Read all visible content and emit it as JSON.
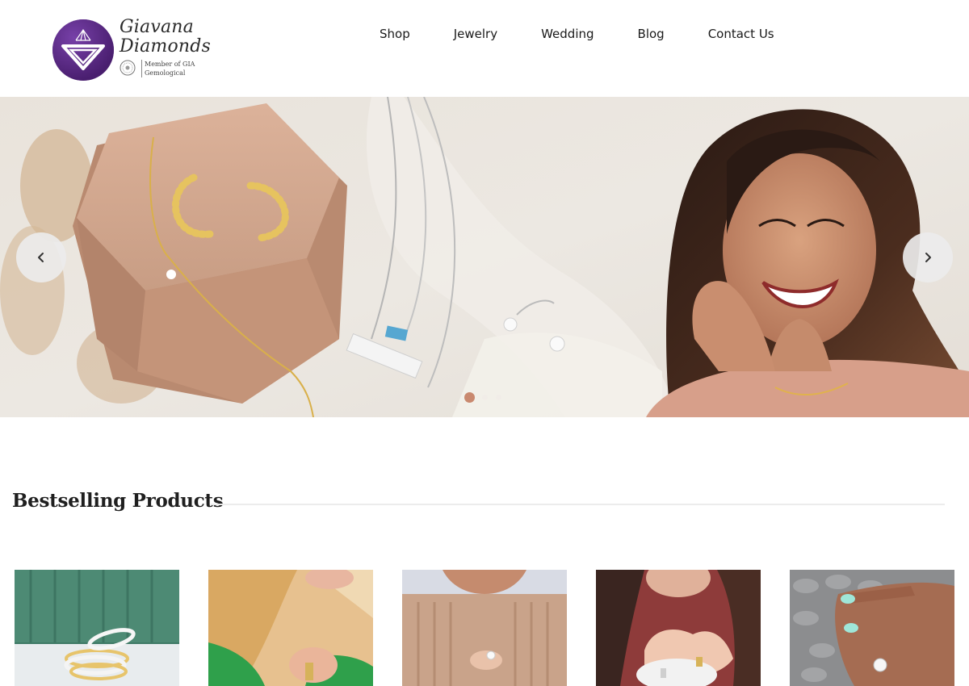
{
  "brand": {
    "name_line1": "Giavana",
    "name_line2": "Diamonds",
    "member_line1": "Member of GIA",
    "member_line2": "Gemological",
    "brand_color": "#5b2a86"
  },
  "nav": {
    "items": [
      {
        "label": "Shop"
      },
      {
        "label": "Jewelry"
      },
      {
        "label": "Wedding"
      },
      {
        "label": "Blog"
      },
      {
        "label": "Contact Us"
      }
    ]
  },
  "hero": {
    "prev_icon": "chevron-left-icon",
    "next_icon": "chevron-right-icon",
    "slide_count": 3,
    "active_slide": 1,
    "accent": "#c9896f"
  },
  "bestselling": {
    "title": "Bestselling Products",
    "products": [
      {
        "image": "stacked-diamond-bands"
      },
      {
        "image": "blonde-woman-ring-stack"
      },
      {
        "image": "beige-sweater-ring"
      },
      {
        "image": "hands-with-rings"
      },
      {
        "image": "engagement-ring-knit"
      }
    ]
  }
}
